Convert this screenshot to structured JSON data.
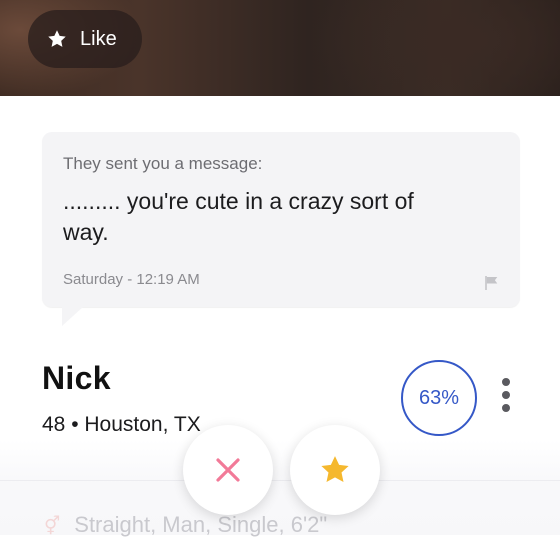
{
  "photo": {
    "like_label": "Like"
  },
  "message": {
    "heading": "They sent you a message:",
    "text": "......... you're cute in a crazy sort of way.",
    "timestamp": "Saturday - 12:19 AM"
  },
  "profile": {
    "name": "Nick",
    "meta": "48 • Houston, TX",
    "match_percent": "63%",
    "details": "Straight, Man, Single, 6'2\""
  },
  "actions": {
    "pass_icon": "close-icon",
    "like_icon": "star-icon"
  },
  "colors": {
    "match_blue": "#3558c7",
    "pass_pink": "#f27a98",
    "star_gold": "#f5b82e"
  }
}
